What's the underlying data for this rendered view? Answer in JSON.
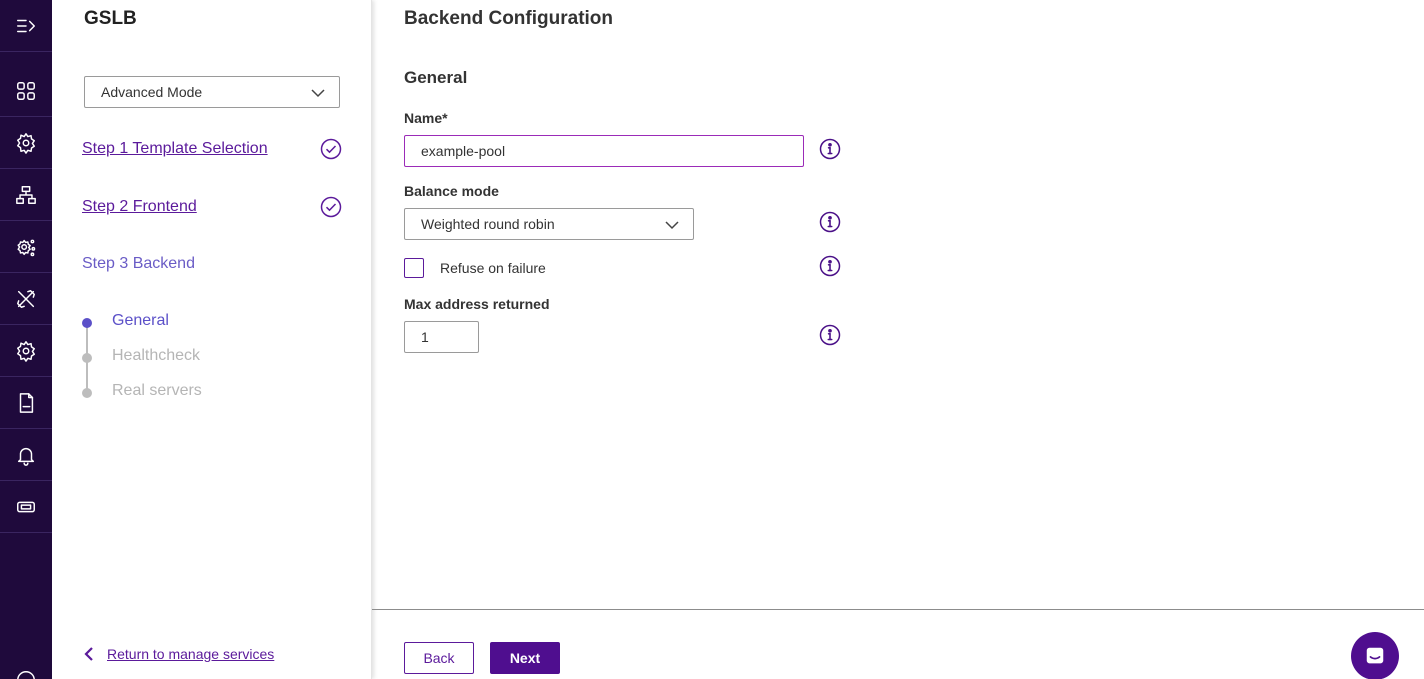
{
  "colors": {
    "rail": "#1f0a3c",
    "accent": "#5b1a9b",
    "active_step": "#5b50c8",
    "primary_button": "#4f0e8f"
  },
  "rail": {
    "items": [
      {
        "icon": "expand-menu-icon"
      },
      {
        "icon": "dashboard-grid-icon"
      },
      {
        "icon": "services-gear-icon"
      },
      {
        "icon": "network-topology-icon"
      },
      {
        "icon": "system-settings-icon"
      },
      {
        "icon": "tools-icon"
      },
      {
        "icon": "settings-gear-icon"
      },
      {
        "icon": "log-file-icon"
      },
      {
        "icon": "notification-bell-icon"
      },
      {
        "icon": "ticket-icon"
      },
      {
        "icon": "info-icon"
      }
    ]
  },
  "wizard": {
    "title": "GSLB",
    "mode_select": {
      "value": "Advanced Mode"
    },
    "steps": [
      {
        "label": "Step 1 Template Selection",
        "state": "completed"
      },
      {
        "label": "Step 2 Frontend",
        "state": "completed"
      },
      {
        "label": "Step 3 Backend",
        "state": "current"
      }
    ],
    "substeps": [
      {
        "label": "General",
        "state": "active"
      },
      {
        "label": "Healthcheck",
        "state": "pending"
      },
      {
        "label": "Real servers",
        "state": "pending"
      }
    ],
    "return_link": "Return to manage services"
  },
  "main": {
    "title": "Backend Configuration",
    "section": "General",
    "name_field": {
      "label": "Name*",
      "value": "example-pool"
    },
    "balance_mode": {
      "label": "Balance mode",
      "value": "Weighted round robin"
    },
    "refuse_on_failure": {
      "label": "Refuse on failure",
      "checked": false
    },
    "max_address": {
      "label": "Max address returned",
      "value": "1"
    },
    "buttons": {
      "back": "Back",
      "next": "Next"
    }
  }
}
